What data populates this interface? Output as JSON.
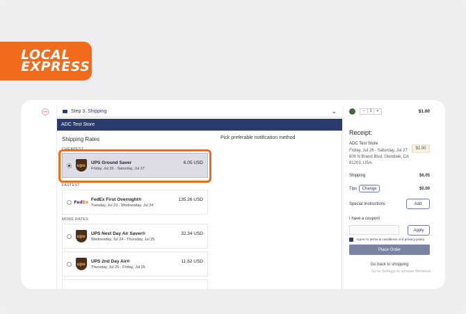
{
  "brand": {
    "logo_line1": "LOCAL",
    "logo_line2": "EXPRESS",
    "accent": "#f26a1b",
    "navy": "#2b3a6f"
  },
  "step": {
    "label": "Step 3. Shipping"
  },
  "store_bar": {
    "title": "ADC Test Store"
  },
  "shipping": {
    "title": "Shipping Rates",
    "notify_title": "Pick preferable notification method",
    "sections": {
      "cheapest": "CHEAPEST",
      "fastest": "FASTEST",
      "more": "MORE RATES"
    },
    "rates": [
      {
        "carrier": "ups",
        "name": "UPS Ground Saver",
        "dates": "Friday, Jul 26 - Saturday, Jul 27",
        "price": "6.05 USD",
        "selected": true
      },
      {
        "carrier": "fedex",
        "name": "FedEx First Overnight®",
        "dates": "Tuesday, Jul 23 - Wednesday, Jul 24",
        "price": "135.26 USD",
        "selected": false
      },
      {
        "carrier": "ups",
        "name": "UPS Next Day Air Saver®",
        "dates": "Wednesday, Jul 24 - Thursday, Jul 25",
        "price": "32.34 USD",
        "selected": false
      },
      {
        "carrier": "ups",
        "name": "UPS 2nd Day Air®",
        "dates": "Thursday, Jul 25 - Friday, Jul 26",
        "price": "11.62 USD",
        "selected": false
      }
    ],
    "ups_glyph": "ups",
    "fedex_glyph_fe": "Fed",
    "fedex_glyph_ex": "Ex"
  },
  "cart": {
    "qty_minus": "−",
    "qty": "1",
    "qty_plus": "+",
    "price": "$1.00"
  },
  "receipt": {
    "title": "Receipt:",
    "store": "ADC Test Store",
    "dates": "Friday, Jul 26 - Saturday, Jul 27",
    "address1": "600 N Brand Blvd, Glendale, CA",
    "address2": "91203, USA",
    "badge": "$1.00",
    "shipping_label": "Shipping",
    "shipping_value": "$6.05",
    "tips_label": "Tips",
    "tips_change": "Change",
    "tips_value": "$0.00",
    "special_label": "Special Instructions",
    "special_add": "Add",
    "coupon_label": "I have a coupon!",
    "coupon_apply": "Apply",
    "agree_prefix": "Agree to",
    "agree_terms": "terms & conditions",
    "agree_and": "and",
    "agree_privacy": "privacy policy",
    "place_order": "Place Order",
    "back_link": "Go back to shopping",
    "watermark": "Go to Settings to activate Windows."
  }
}
